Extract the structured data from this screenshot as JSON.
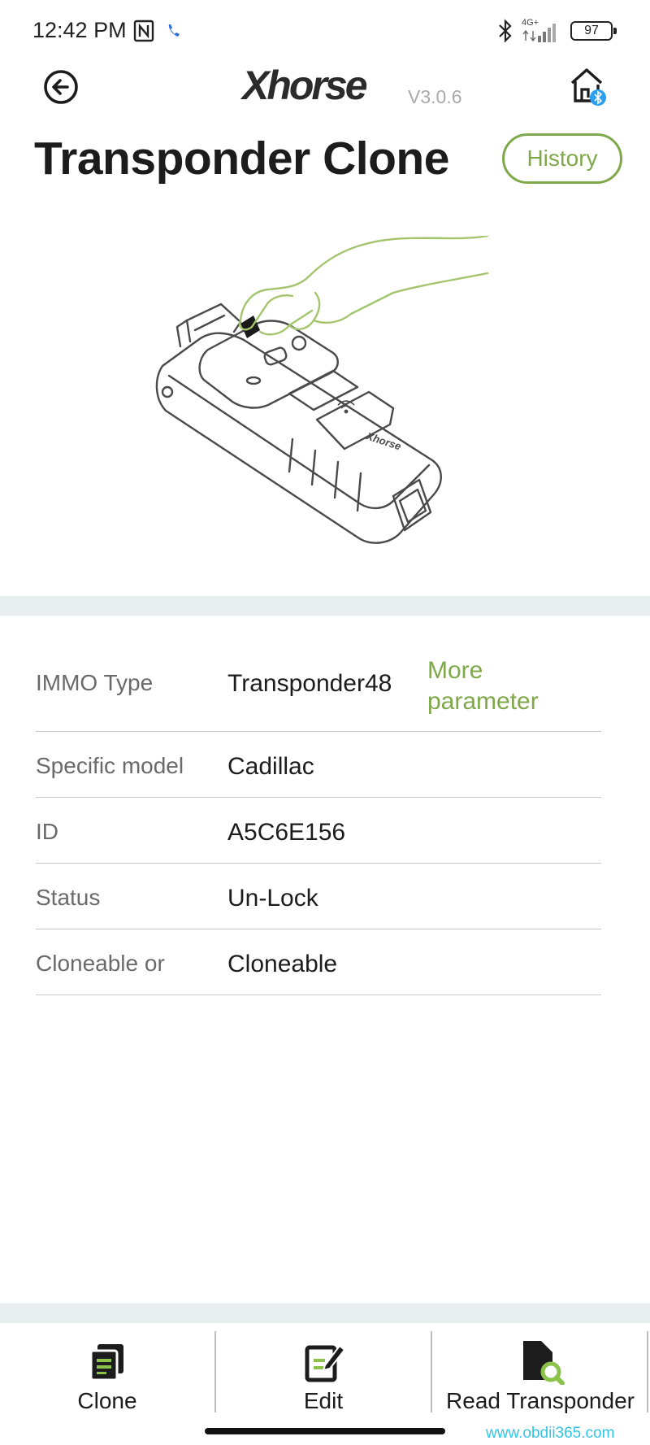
{
  "status_bar": {
    "time": "12:42 PM",
    "network": "4G+",
    "battery": "97"
  },
  "header": {
    "logo_alt": "Xhorse",
    "version": "V3.0.6",
    "title": "Transponder Clone",
    "history_label": "History"
  },
  "info": {
    "rows": [
      {
        "label": "IMMO Type",
        "value": "Transponder48"
      },
      {
        "label": "Specific model",
        "value": "Cadillac"
      },
      {
        "label": "ID",
        "value": "A5C6E156"
      },
      {
        "label": "Status",
        "value": "Un-Lock"
      },
      {
        "label": "Cloneable or",
        "value": "Cloneable"
      }
    ],
    "more_parameter": "More parameter"
  },
  "bottom_nav": {
    "items": [
      {
        "label": "Clone",
        "icon": "clone-icon"
      },
      {
        "label": "Edit",
        "icon": "edit-icon"
      },
      {
        "label": "Read Transponder",
        "icon": "read-transponder-icon"
      }
    ]
  },
  "watermark": "www.obdii365.com",
  "colors": {
    "accent": "#7fa84a",
    "band": "#e9eef0",
    "bluetooth": "#2a9ef0",
    "watermark": "#34c5e6"
  }
}
